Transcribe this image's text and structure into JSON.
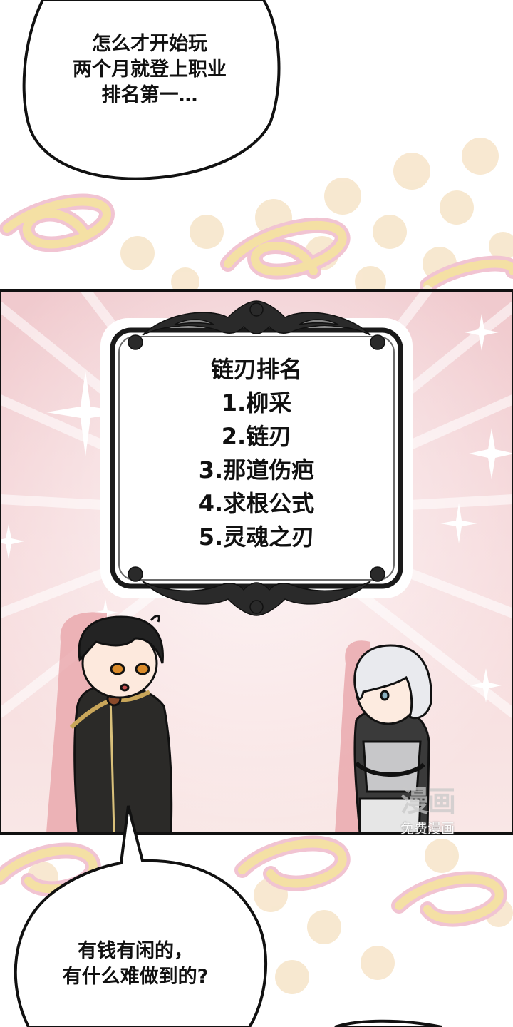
{
  "top_bubble": {
    "lines": [
      "怎么才开始玩",
      "两个月就登上职业",
      "排名第一…"
    ]
  },
  "ranking_panel": {
    "title": "链刃排名",
    "entries": [
      "1.柳采",
      "2.链刃",
      "3.那道伤疤",
      "4.求根公式",
      "5.灵魂之刃"
    ]
  },
  "bottom_bubble": {
    "lines": [
      "有钱有闲的，",
      "有什么难做到的?"
    ]
  },
  "watermark": {
    "logo": "漫画",
    "caption": "免费漫画"
  },
  "colors": {
    "panel_pink": "#f2cfd2",
    "panel_pink_light": "#fbe9ea",
    "background_dots": "#f6e3c6",
    "swirl_yellow": "#f4e0a4",
    "swirl_pink": "#f1c4d2",
    "outline": "#111111"
  }
}
